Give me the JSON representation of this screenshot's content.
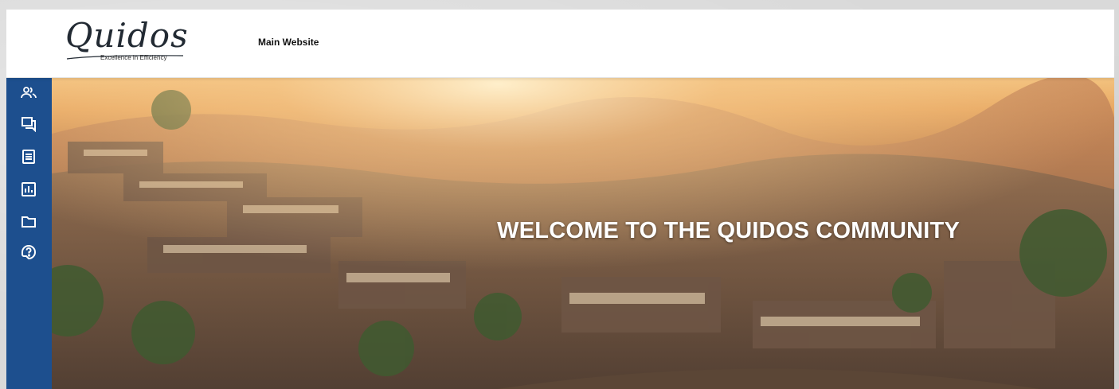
{
  "header": {
    "logo_text": "Quidos",
    "logo_tagline": "Excellence in Efficiency",
    "nav_link": "Main Website"
  },
  "sidebar": {
    "items": [
      {
        "icon": "community-icon"
      },
      {
        "icon": "discussions-icon"
      },
      {
        "icon": "articles-icon"
      },
      {
        "icon": "reports-icon"
      },
      {
        "icon": "folder-icon"
      },
      {
        "icon": "help-icon"
      }
    ],
    "color": "#1d4f8e"
  },
  "hero": {
    "title": "WELCOME TO THE QUIDOS COMMUNITY"
  }
}
